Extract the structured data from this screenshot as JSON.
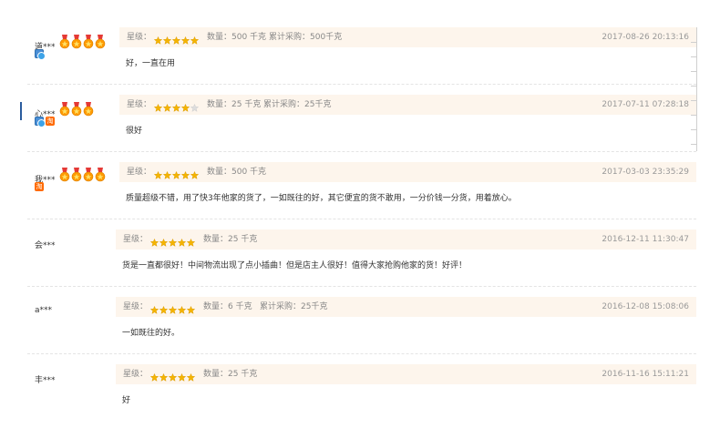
{
  "rating_label": "星级：",
  "quantity_label_prefix": "数量：",
  "cumulative_label_prefix": "累计采购：",
  "colors": {
    "meta_bg": "#fdf5ec",
    "star": "#f5b400",
    "medal": "#ff9a00"
  },
  "reviews": [
    {
      "user": "道***",
      "medals": 4,
      "badges": [
        "vip-icon"
      ],
      "stars": 5,
      "quantity": "500 千克",
      "cumulative": "500千克",
      "time": "2017-08-26 20:13:16",
      "content": "好，一直在用"
    },
    {
      "user": "心***",
      "medals": 3,
      "badges": [
        "vip-icon",
        "tao-icon"
      ],
      "stars": 4,
      "quantity": "25 千克",
      "cumulative": "25千克",
      "time": "2017-07-11 07:28:18",
      "content": "很好"
    },
    {
      "user": "我***",
      "medals": 4,
      "badges": [
        "tao-icon"
      ],
      "stars": 5,
      "quantity": "500 千克",
      "cumulative": "",
      "time": "2017-03-03 23:35:29",
      "content": "质量超级不错，用了快3年他家的货了，一如既往的好，其它便宜的货不敢用，一分价钱一分货，用着放心。"
    },
    {
      "user": "会***",
      "medals": 0,
      "badges": [],
      "stars": 5,
      "quantity": "25 千克",
      "cumulative": "",
      "time": "2016-12-11 11:30:47",
      "content": "货是一直都很好！中间物流出现了点小插曲！但是店主人很好！值得大家抢购他家的货！好评！"
    },
    {
      "user": "a***",
      "medals": 0,
      "badges": [],
      "stars": 5,
      "quantity": "6 千克",
      "cumulative": "25千克",
      "time": "2016-12-08 15:08:06",
      "content": "一如既往的好。"
    },
    {
      "user": "丰***",
      "medals": 0,
      "badges": [],
      "stars": 5,
      "quantity": "25 千克",
      "cumulative": "",
      "time": "2016-11-16 15:11:21",
      "content": "好"
    }
  ]
}
